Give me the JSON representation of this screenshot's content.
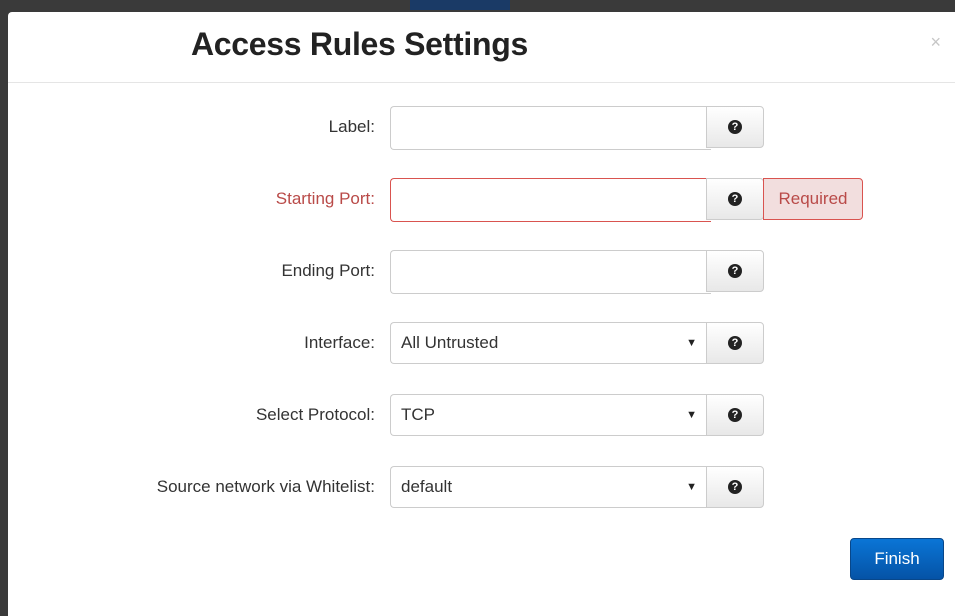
{
  "modal": {
    "title": "Access Rules Settings",
    "close_glyph": "×"
  },
  "form": {
    "label": {
      "label": "Label:",
      "value": "",
      "help_icon": "question-circle-icon"
    },
    "starting_port": {
      "label": "Starting Port:",
      "value": "",
      "validation": "Required",
      "help_icon": "question-circle-icon"
    },
    "ending_port": {
      "label": "Ending Port:",
      "value": "",
      "help_icon": "question-circle-icon"
    },
    "interface": {
      "label": "Interface:",
      "selected": "All Untrusted",
      "help_icon": "question-circle-icon"
    },
    "protocol": {
      "label": "Select Protocol:",
      "selected": "TCP",
      "help_icon": "question-circle-icon"
    },
    "whitelist": {
      "label": "Source network via Whitelist:",
      "selected": "default",
      "help_icon": "question-circle-icon"
    }
  },
  "help_glyph": "?",
  "caret_glyph": "▼",
  "finish_label": "Finish",
  "colors": {
    "error_text": "#b94a48",
    "error_bg": "#f2dede",
    "primary": "#0a6fd0"
  }
}
